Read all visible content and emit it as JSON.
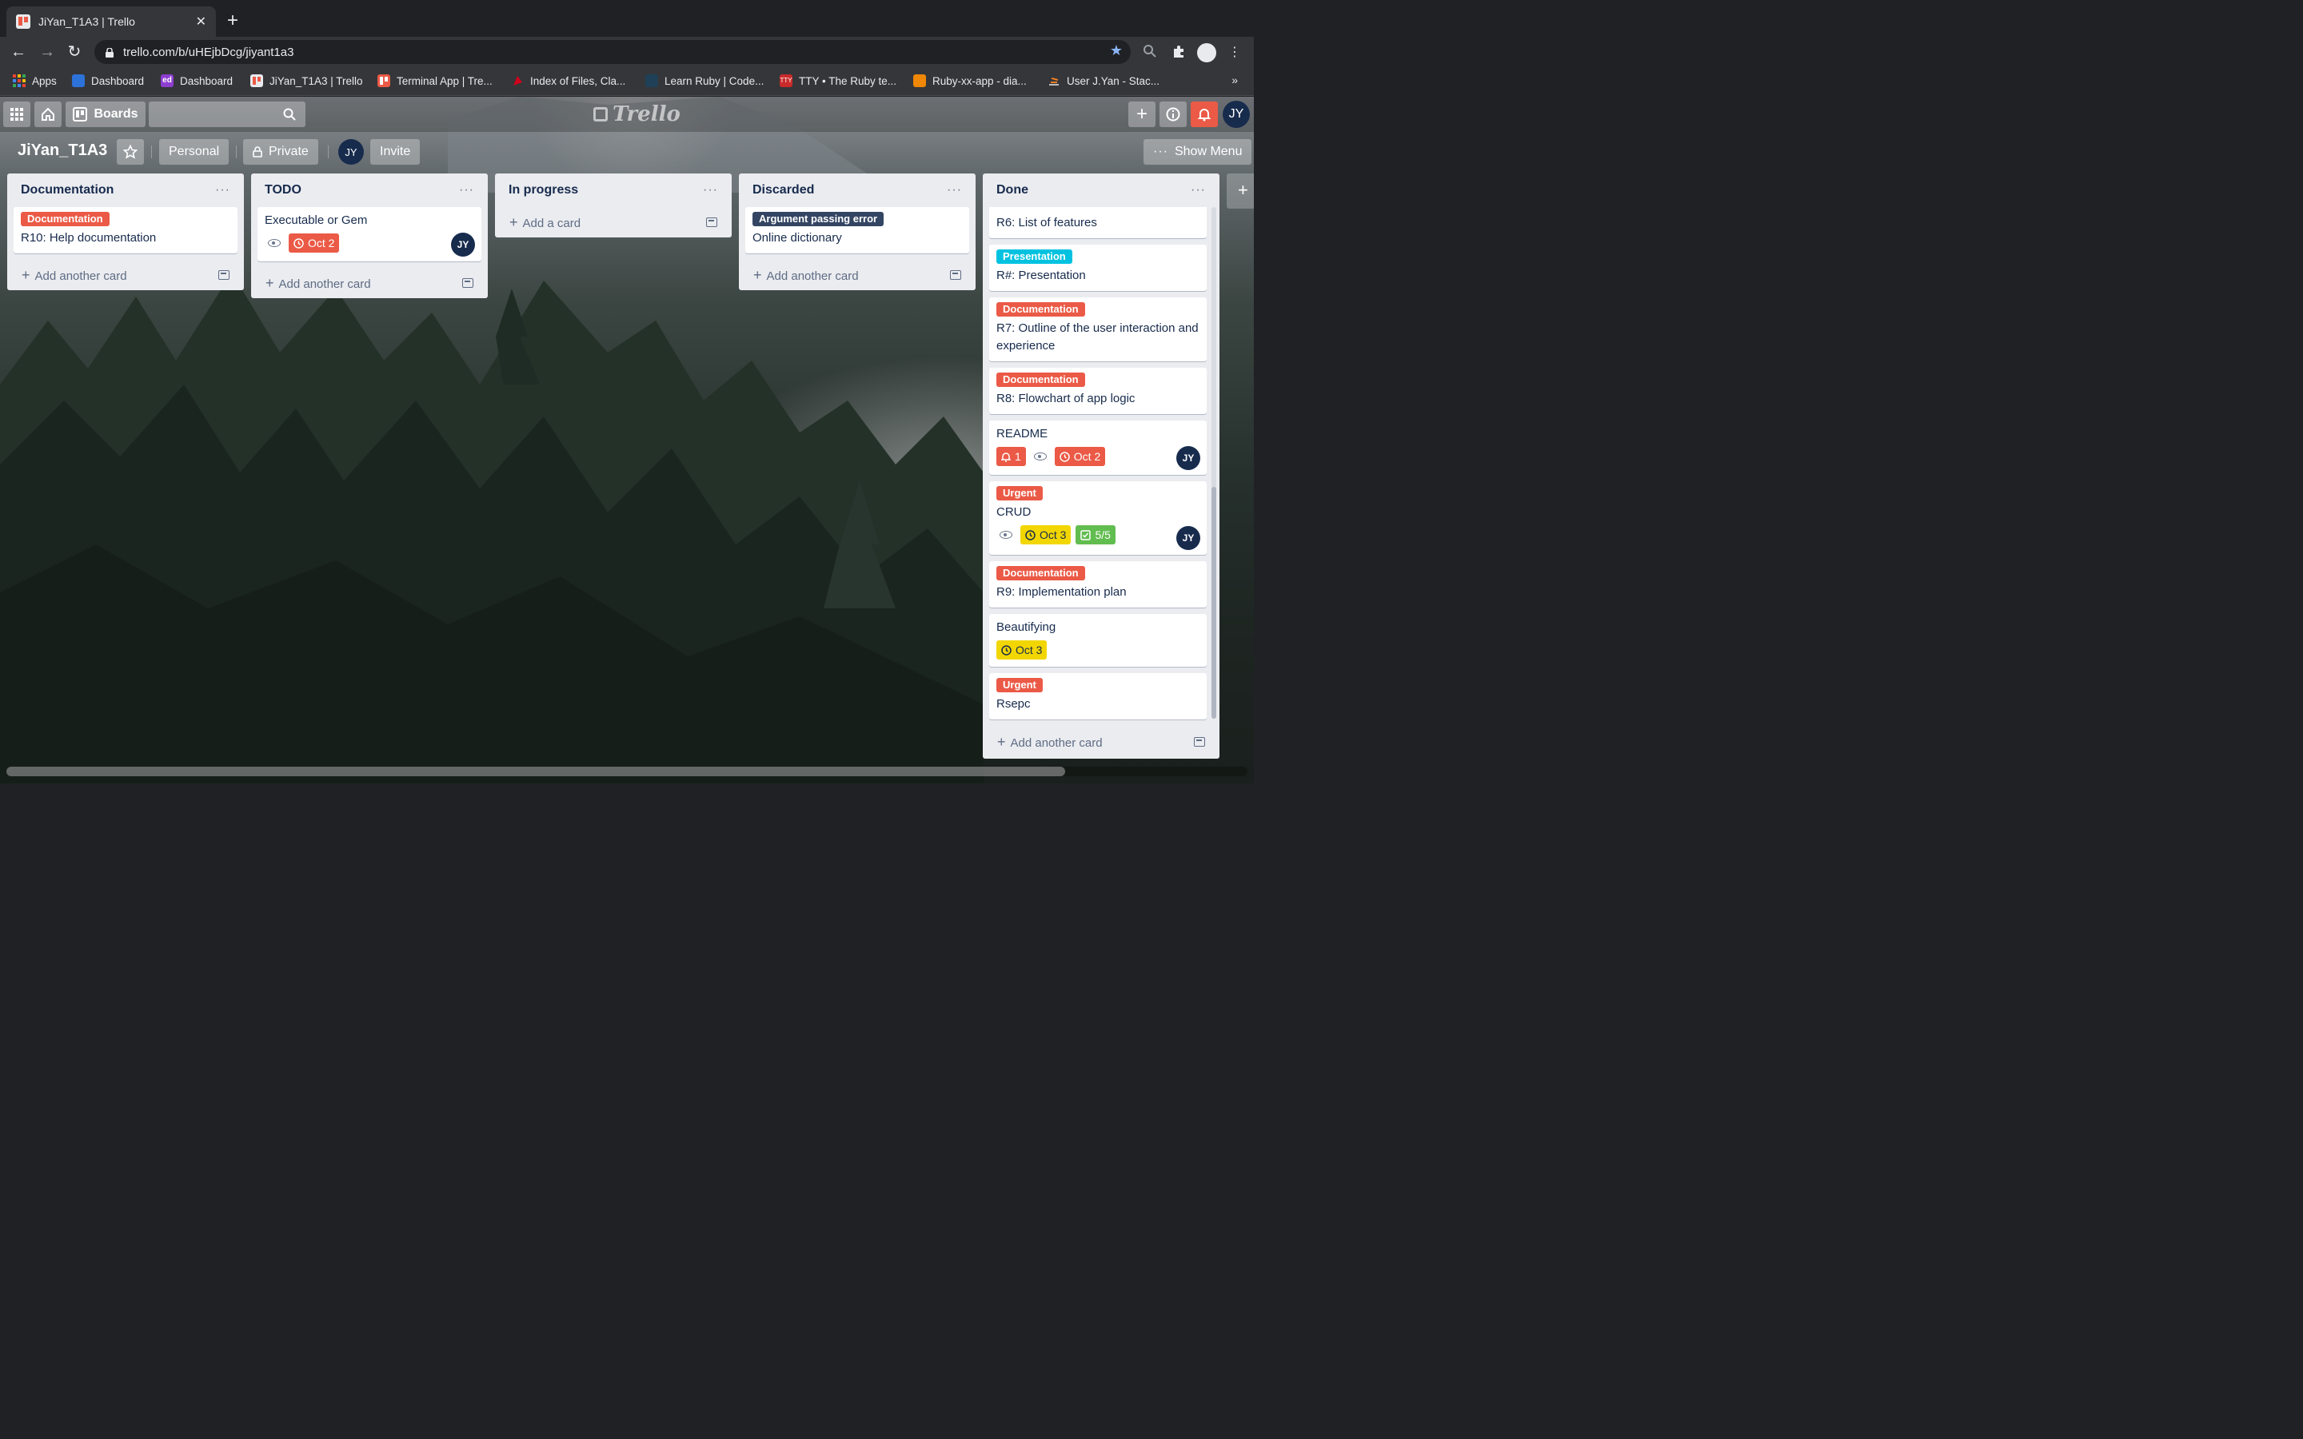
{
  "browser": {
    "tab_title": "JiYan_T1A3 | Trello",
    "url": "trello.com/b/uHEjbDcg/jiyant1a3",
    "bookmarks": [
      {
        "label": "Apps",
        "icon": "apps-grid-icon",
        "color": "#ea4335"
      },
      {
        "label": "Dashboard",
        "icon": "canvas-icon",
        "color": "#2d72d9"
      },
      {
        "label": "Dashboard",
        "icon": "ed-icon",
        "color": "#8e3fd1"
      },
      {
        "label": "JiYan_T1A3 | Trello",
        "icon": "trello-icon",
        "color": "#eb5a46"
      },
      {
        "label": "Terminal App | Tre...",
        "icon": "trello-icon",
        "color": "#eb5a46"
      },
      {
        "label": "Index of Files, Cla...",
        "icon": "ruby-doc-icon",
        "color": "#d0021b"
      },
      {
        "label": "Learn Ruby | Code...",
        "icon": "codecademy-icon",
        "color": "#1f4056"
      },
      {
        "label": "TTY • The Ruby te...",
        "icon": "tty-icon",
        "color": "#c92a2a"
      },
      {
        "label": "Ruby-xx-app - dia...",
        "icon": "drawio-icon",
        "color": "#f08705"
      },
      {
        "label": "User J.Yan - Stac...",
        "icon": "stackoverflow-icon",
        "color": "#f48024"
      }
    ],
    "bookmarks_overflow": "»"
  },
  "appbar": {
    "boards_label": "Boards",
    "logo_text": "Trello",
    "user_initials": "JY"
  },
  "board": {
    "title": "JiYan_T1A3",
    "visibility_team": "Personal",
    "visibility": "Private",
    "member_initials": "JY",
    "invite_label": "Invite",
    "show_menu_label": "Show Menu"
  },
  "colors": {
    "red": "#eb5a46",
    "navy": "#344563",
    "sky": "#00c2e0",
    "yellow": "#f2d600",
    "green": "#61bd4f",
    "due_red": "#eb5a46"
  },
  "lists": [
    {
      "title": "Documentation",
      "add_label": "Add another card",
      "cards": [
        {
          "labels": [
            {
              "text": "Documentation",
              "color": "#eb5a46"
            }
          ],
          "title": "R10: Help documentation"
        }
      ]
    },
    {
      "title": "TODO",
      "add_label": "Add another card",
      "cards": [
        {
          "labels": [],
          "title": "Executable or Gem",
          "watch": true,
          "due": "Oct 2",
          "due_color": "#eb5a46",
          "member": "JY"
        }
      ]
    },
    {
      "title": "In progress",
      "add_label": "Add a card",
      "cards": []
    },
    {
      "title": "Discarded",
      "add_label": "Add another card",
      "cards": [
        {
          "labels": [
            {
              "text": "Argument passing error",
              "color": "#344563"
            }
          ],
          "title": "Online dictionary"
        }
      ]
    },
    {
      "title": "Done",
      "add_label": "Add another card",
      "cards": [
        {
          "labels": [],
          "title": "R6: List of features"
        },
        {
          "labels": [
            {
              "text": "Presentation",
              "color": "#00c2e0"
            }
          ],
          "title": "R#: Presentation"
        },
        {
          "labels": [
            {
              "text": "Documentation",
              "color": "#eb5a46"
            }
          ],
          "title": "R7: Outline of the user interaction and experience"
        },
        {
          "labels": [
            {
              "text": "Documentation",
              "color": "#eb5a46"
            }
          ],
          "title": "R8: Flowchart of app logic"
        },
        {
          "labels": [],
          "title": "README",
          "notifications": "1",
          "watch": true,
          "due": "Oct 2",
          "due_color": "#eb5a46",
          "member": "JY"
        },
        {
          "labels": [
            {
              "text": "Urgent",
              "color": "#eb5a46"
            }
          ],
          "title": "CRUD",
          "watch": true,
          "due": "Oct 3",
          "due_color": "#f2d600",
          "checklist": "5/5",
          "member": "JY"
        },
        {
          "labels": [
            {
              "text": "Documentation",
              "color": "#eb5a46"
            }
          ],
          "title": "R9: Implementation plan"
        },
        {
          "labels": [],
          "title": "Beautifying",
          "due": "Oct 3",
          "due_color": "#f2d600"
        },
        {
          "labels": [
            {
              "text": "Urgent",
              "color": "#eb5a46"
            }
          ],
          "title": "Rsepc"
        }
      ]
    }
  ]
}
